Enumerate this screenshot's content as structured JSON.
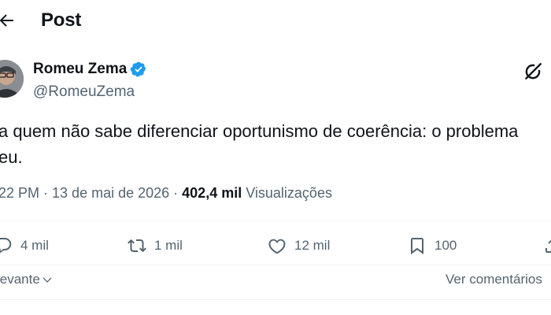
{
  "header": {
    "title": "Post"
  },
  "author": {
    "name": "Romeu Zema",
    "handle": "@RomeuZema",
    "verified": true,
    "verified_color": "#1d9bf0"
  },
  "post": {
    "text_line1": "a quem não sabe diferenciar oportunismo de coerência: o problema",
    "text_line2": "eu."
  },
  "meta": {
    "time": "22 PM",
    "sep1": " · ",
    "date": "13 de mai de 2026",
    "sep2": " · ",
    "views_count": "402,4 mil",
    "views_label": " Visualizações"
  },
  "actions": {
    "replies": "4 mil",
    "reposts": "1 mil",
    "likes": "12 mil",
    "bookmarks": "100"
  },
  "icons": {
    "back": "arrow-left-icon",
    "grok": "grok-icon",
    "reply": "reply-icon",
    "repost": "repost-icon",
    "like": "heart-icon",
    "bookmark": "bookmark-icon",
    "share": "share-icon"
  },
  "sort": {
    "label": "levante",
    "view_comments": "Ver comentários"
  }
}
